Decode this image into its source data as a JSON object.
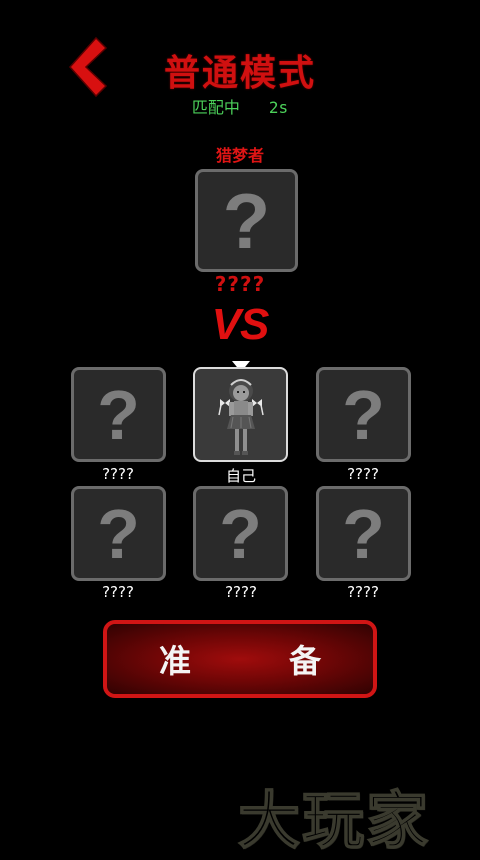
{
  "header": {
    "title": "普通模式",
    "status_text": "匹配中",
    "timer": "2s",
    "back_icon": "chevron-left-icon"
  },
  "hunter": {
    "role_label": "猎梦者",
    "name": "????",
    "placeholder_glyph": "?"
  },
  "vs_label": "VS",
  "players": [
    {
      "name": "????",
      "is_self": false,
      "placeholder_glyph": "?"
    },
    {
      "name": "自己",
      "is_self": true
    },
    {
      "name": "????",
      "is_self": false,
      "placeholder_glyph": "?"
    },
    {
      "name": "????",
      "is_self": false,
      "placeholder_glyph": "?"
    },
    {
      "name": "????",
      "is_self": false,
      "placeholder_glyph": "?"
    },
    {
      "name": "????",
      "is_self": false,
      "placeholder_glyph": "?"
    }
  ],
  "ready_button": {
    "left_char": "准",
    "right_char": "备"
  },
  "watermark": "大玩家",
  "colors": {
    "accent_red": "#d01010",
    "status_green": "#4cd15a",
    "background": "#000000"
  }
}
